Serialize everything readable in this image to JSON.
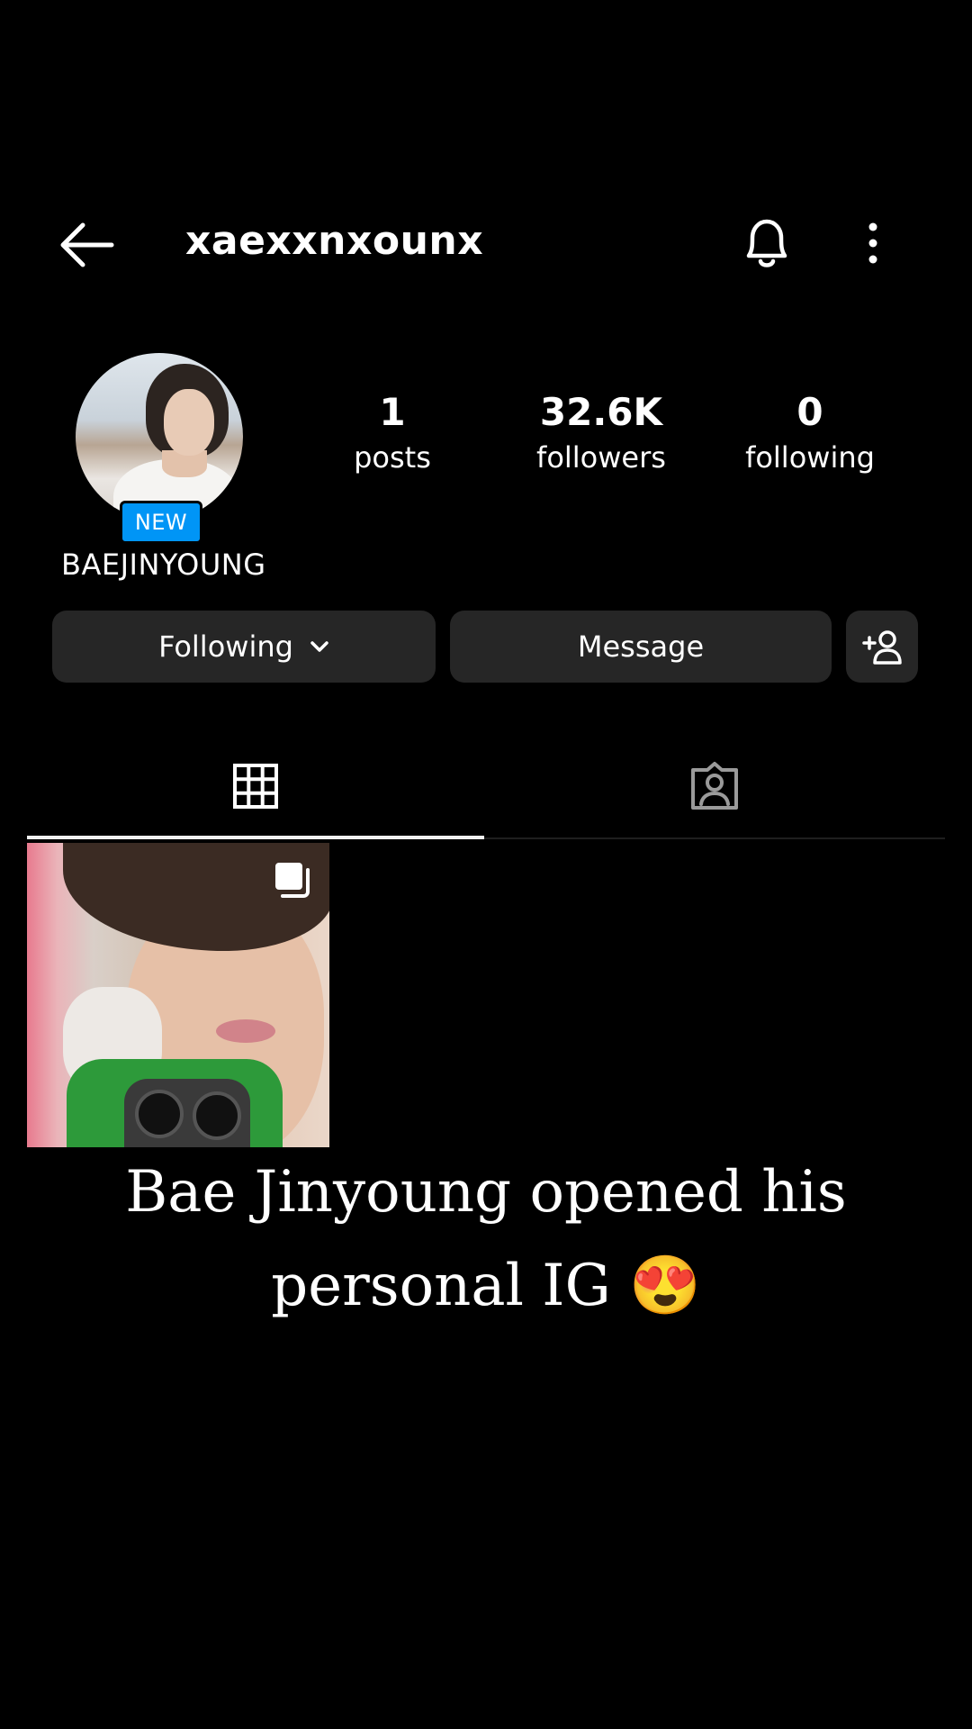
{
  "header": {
    "username": "xaexxnxounx",
    "icons": {
      "back": "arrow-left-icon",
      "notifications": "bell-icon",
      "more": "more-vertical-icon"
    }
  },
  "profile": {
    "new_badge": "NEW",
    "display_name": "BAEJINYOUNG",
    "stats": [
      {
        "value": "1",
        "label": "posts"
      },
      {
        "value": "32.6K",
        "label": "followers"
      },
      {
        "value": "0",
        "label": "following"
      }
    ]
  },
  "actions": {
    "following_label": "Following",
    "message_label": "Message",
    "icons": {
      "following_menu": "chevron-down-icon",
      "add_friend": "add-person-icon"
    }
  },
  "tabs": [
    {
      "name": "posts",
      "icon": "grid-icon",
      "active": true
    },
    {
      "name": "tagged",
      "icon": "tagged-person-icon",
      "active": false
    }
  ],
  "posts": [
    {
      "icon": "multiple-photos-icon"
    }
  ],
  "caption": {
    "text": "Bae Jinyoung opened his personal IG 😍"
  },
  "colors": {
    "background": "#000000",
    "button": "#262626",
    "badge": "#0095f6"
  }
}
